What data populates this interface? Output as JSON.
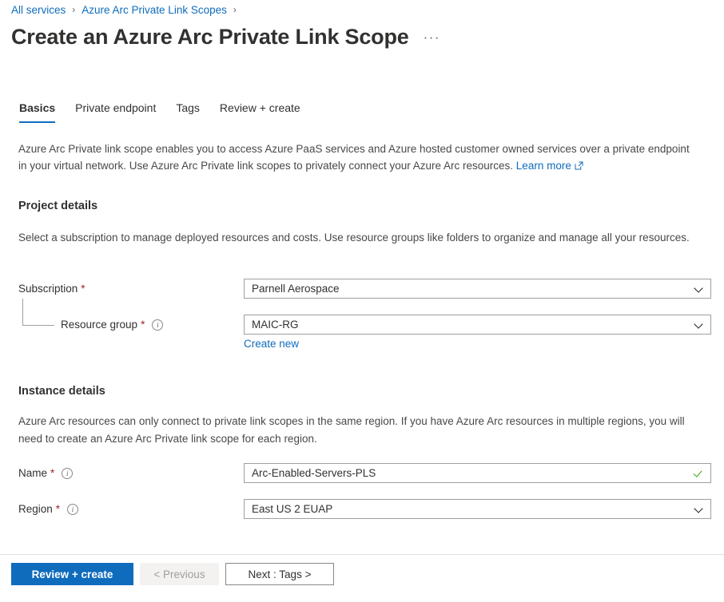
{
  "breadcrumb": {
    "items": [
      {
        "label": "All services"
      },
      {
        "label": "Azure Arc Private Link Scopes"
      }
    ],
    "separator": "›"
  },
  "header": {
    "title": "Create an Azure Arc Private Link Scope",
    "more_label": "···"
  },
  "tabs": [
    {
      "label": "Basics",
      "active": true
    },
    {
      "label": "Private endpoint",
      "active": false
    },
    {
      "label": "Tags",
      "active": false
    },
    {
      "label": "Review + create",
      "active": false
    }
  ],
  "intro": {
    "text": "Azure Arc Private link scope enables you to access Azure PaaS services and Azure hosted customer owned services over a private endpoint in your virtual network. Use Azure Arc Private link scopes to privately connect your Azure Arc resources.",
    "learn_more": "Learn more"
  },
  "project_details": {
    "heading": "Project details",
    "description": "Select a subscription to manage deployed resources and costs. Use resource groups like folders to organize and manage all your resources.",
    "subscription": {
      "label": "Subscription",
      "required": "*",
      "value": "Parnell Aerospace"
    },
    "resource_group": {
      "label": "Resource group",
      "required": "*",
      "value": "MAIC-RG",
      "create_new": "Create new"
    }
  },
  "instance_details": {
    "heading": "Instance details",
    "description": "Azure Arc resources can only connect to private link scopes in the same region. If you have Azure Arc resources in multiple regions, you will need to create an Azure Arc Private link scope for each region.",
    "name": {
      "label": "Name",
      "required": "*",
      "value": "Arc-Enabled-Servers-PLS"
    },
    "region": {
      "label": "Region",
      "required": "*",
      "value": "East US 2 EUAP"
    }
  },
  "footer": {
    "review_create": "Review + create",
    "previous": "< Previous",
    "next": "Next : Tags >"
  },
  "colors": {
    "accent": "#0f6cbd",
    "required": "#a4262c",
    "valid": "#3aa505",
    "text": "#323130"
  }
}
